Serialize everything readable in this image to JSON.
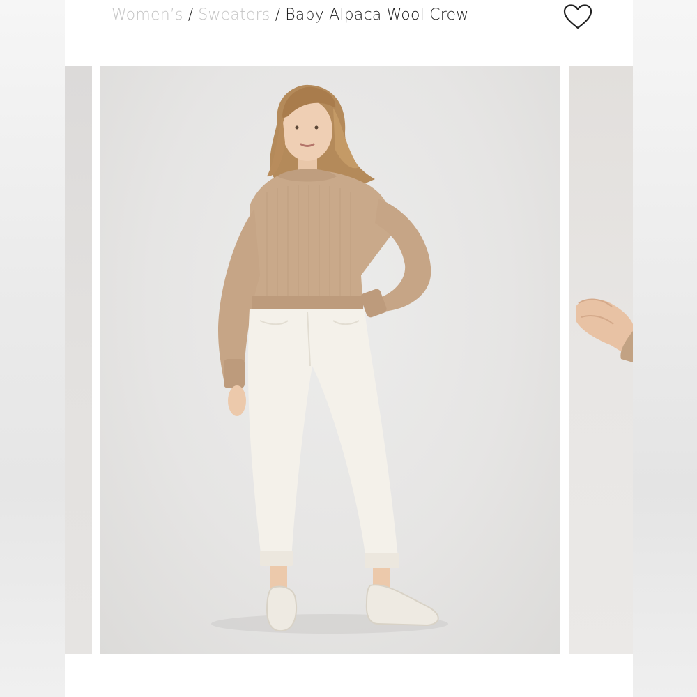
{
  "breadcrumb": {
    "items": [
      "Women’s",
      "Sweaters"
    ],
    "separator": "/",
    "current": "Baby Alpaca Wool Crew"
  },
  "favorite": {
    "icon": "heart-outline-icon"
  },
  "gallery": {
    "images": [
      {
        "name": "previous-product-image"
      },
      {
        "name": "main-product-image",
        "subject": "model wearing beige knit crew sweater with white jeans and sneakers"
      },
      {
        "name": "next-product-image",
        "subject": "close-up of hands and sweater sleeve"
      }
    ]
  },
  "colors": {
    "breadcrumb_link": "#c4c4c4",
    "breadcrumb_current": "#222222",
    "sweater": "#c9a98a",
    "background": "#e6e5e4"
  }
}
